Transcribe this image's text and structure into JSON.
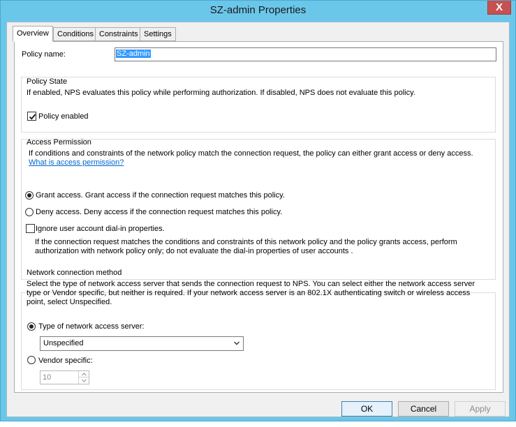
{
  "window": {
    "title": "SZ-admin Properties",
    "close_label": "X"
  },
  "tabs": [
    {
      "label": "Overview",
      "active": true
    },
    {
      "label": "Conditions"
    },
    {
      "label": "Constraints"
    },
    {
      "label": "Settings"
    }
  ],
  "policy_name": {
    "label": "Policy name:",
    "value": "SZ-admin"
  },
  "policy_state": {
    "title": "Policy State",
    "description": "If enabled, NPS evaluates this policy while performing authorization. If disabled, NPS does not evaluate this policy.",
    "enabled_label": "Policy enabled",
    "enabled_checked": true
  },
  "access_permission": {
    "title": "Access Permission",
    "description": "If conditions and constraints of the network policy match the connection request, the policy can either grant access or deny access.",
    "link": "What is access permission?",
    "grant_label": "Grant access. Grant access if the connection request matches this policy.",
    "deny_label": "Deny access. Deny access if the connection request matches this policy.",
    "selected": "grant",
    "ignore_label": "Ignore user account dial-in properties.",
    "ignore_checked": false,
    "ignore_note": "If the connection request matches the conditions and constraints of this network policy and the policy grants access, perform authorization with network policy only; do not evaluate the dial-in properties of user accounts ."
  },
  "network_method": {
    "title": "Network connection method",
    "description": "Select the type of network access server that sends the connection request to NPS. You can select either the network access server type or Vendor specific, but neither is required.  If your network access server is an 802.1X authenticating switch or wireless access point, select Unspecified.",
    "type_label": "Type of network access server:",
    "type_value": "Unspecified",
    "vendor_label": "Vendor specific:",
    "vendor_value": "10",
    "selected": "type"
  },
  "buttons": {
    "ok": "OK",
    "cancel": "Cancel",
    "apply": "Apply"
  }
}
